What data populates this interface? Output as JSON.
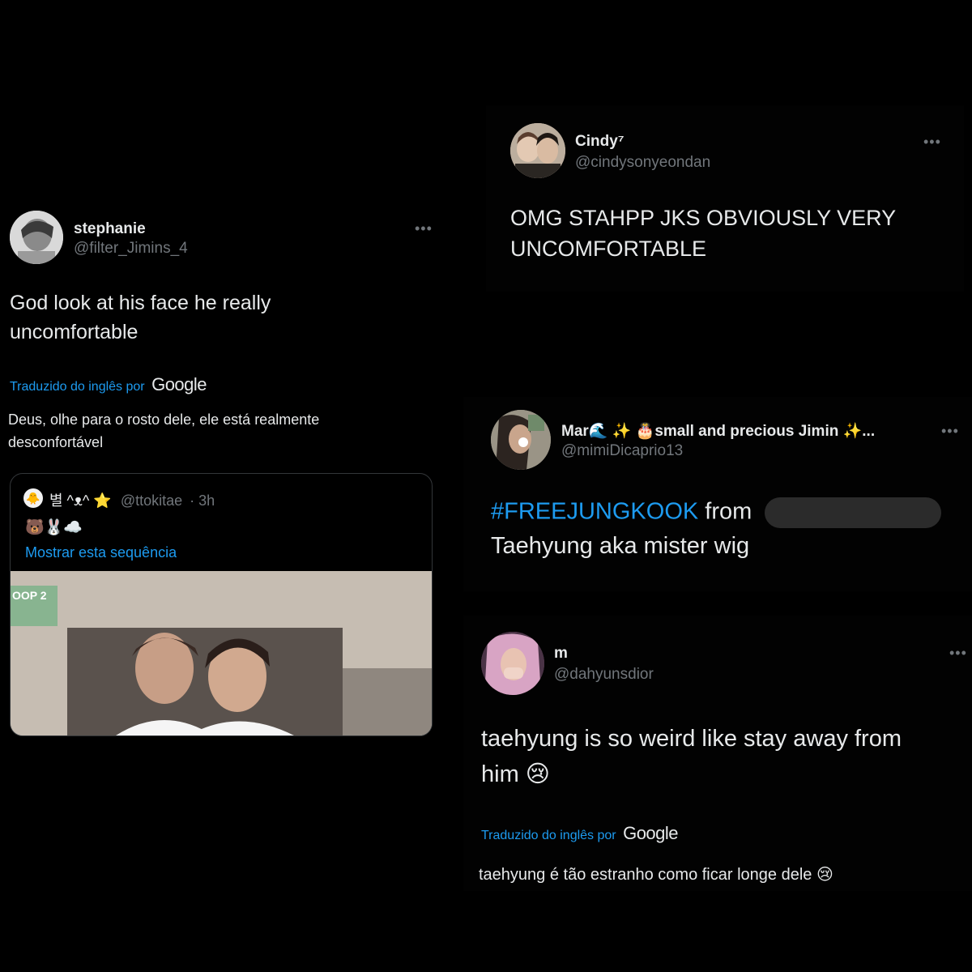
{
  "tweet1": {
    "name": "stephanie",
    "handle": "@filter_Jimins_4",
    "more": "•••",
    "text_line1": "God look at his face he really",
    "text_line2": "uncomfortable",
    "translated_label": "Traduzido do inglês por",
    "translated_brand": "Google",
    "translation_line1": "Deus, olhe para o rosto dele, ele está realmente",
    "translation_line2": "desconfortável",
    "quote": {
      "name": "별 ^ᴥ^ ⭐",
      "handle": "@ttokitae",
      "time": "· 3h",
      "emojis": "🐻🐰☁️",
      "show_thread": "Mostrar esta sequência",
      "media_label": "OOP 2"
    }
  },
  "tweet2": {
    "name": "Cindy⁷",
    "handle": "@cindysonyeondan",
    "more": "•••",
    "text_line1": "OMG STAHPP JKS OBVIOUSLY VERY",
    "text_line2": "UNCOMFORTABLE"
  },
  "tweet3": {
    "name": "Mar🌊 ✨ 🎂small and precious Jimin ✨...",
    "handle": "@mimiDicaprio13",
    "more": "•••",
    "hashtag": "#FREEJUNGKOOK",
    "text_from": "from",
    "text_line2": "Taehyung aka mister wig"
  },
  "tweet4": {
    "name": "m",
    "handle": "@dahyunsdior",
    "more": "•••",
    "text_line1": "taehyung is so weird like stay away from",
    "text_line2": "him 😢",
    "translated_label": "Traduzido do inglês por",
    "translated_brand": "Google",
    "translation_line1": "taehyung é tão estranho como ficar longe dele 😢"
  },
  "colors": {
    "background": "#000000",
    "text": "#e7e9ea",
    "secondary": "#71767b",
    "link": "#1d9bf0"
  }
}
